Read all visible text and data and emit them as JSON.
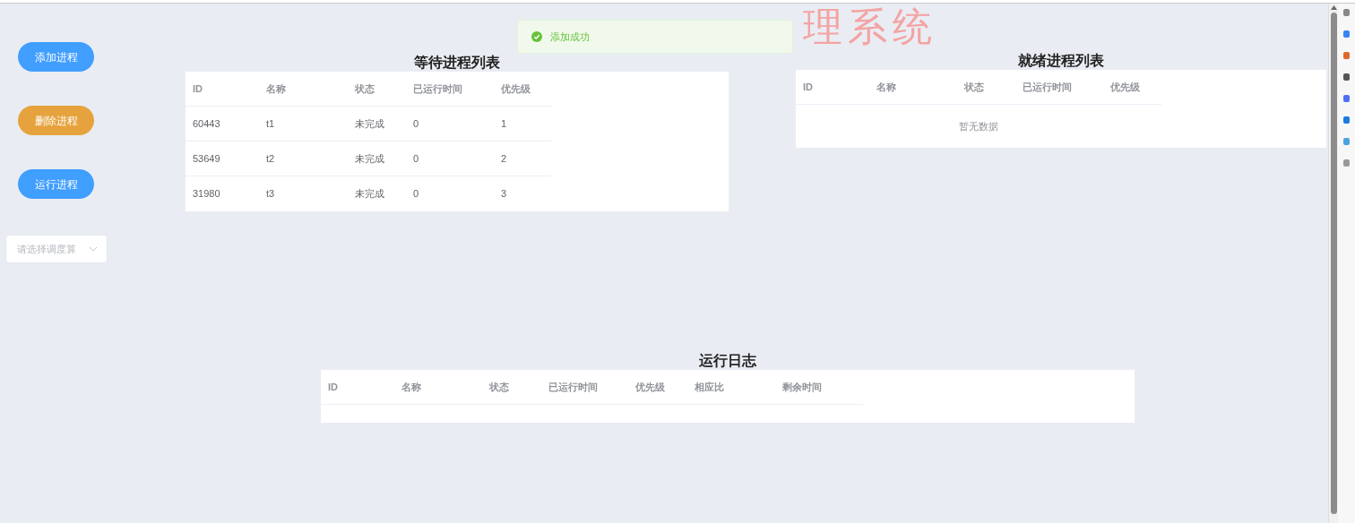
{
  "title": "理系统",
  "toast": {
    "kind": "success",
    "text": "添加成功"
  },
  "buttons": [
    {
      "label": "添加进程",
      "kind": "primary"
    },
    {
      "label": "删除进程",
      "kind": "warning"
    },
    {
      "label": "运行进程",
      "kind": "primary"
    }
  ],
  "select": {
    "placeholder": "请选择调度算"
  },
  "waiting_table": {
    "title": "等待进程列表",
    "columns": [
      "ID",
      "名称",
      "状态",
      "已运行时间",
      "优先级"
    ],
    "rows": [
      [
        "60443",
        "t1",
        "未完成",
        "0",
        "1"
      ],
      [
        "53649",
        "t2",
        "未完成",
        "0",
        "2"
      ],
      [
        "31980",
        "t3",
        "未完成",
        "0",
        "3"
      ]
    ]
  },
  "ready_table": {
    "title": "就绪进程列表",
    "columns": [
      "ID",
      "名称",
      "状态",
      "已运行时间",
      "优先级"
    ],
    "empty_text": "暂无数据"
  },
  "log_table": {
    "title": "运行日志",
    "columns": [
      "ID",
      "名称",
      "状态",
      "已运行时间",
      "优先级",
      "相应比",
      "剩余时间"
    ]
  }
}
